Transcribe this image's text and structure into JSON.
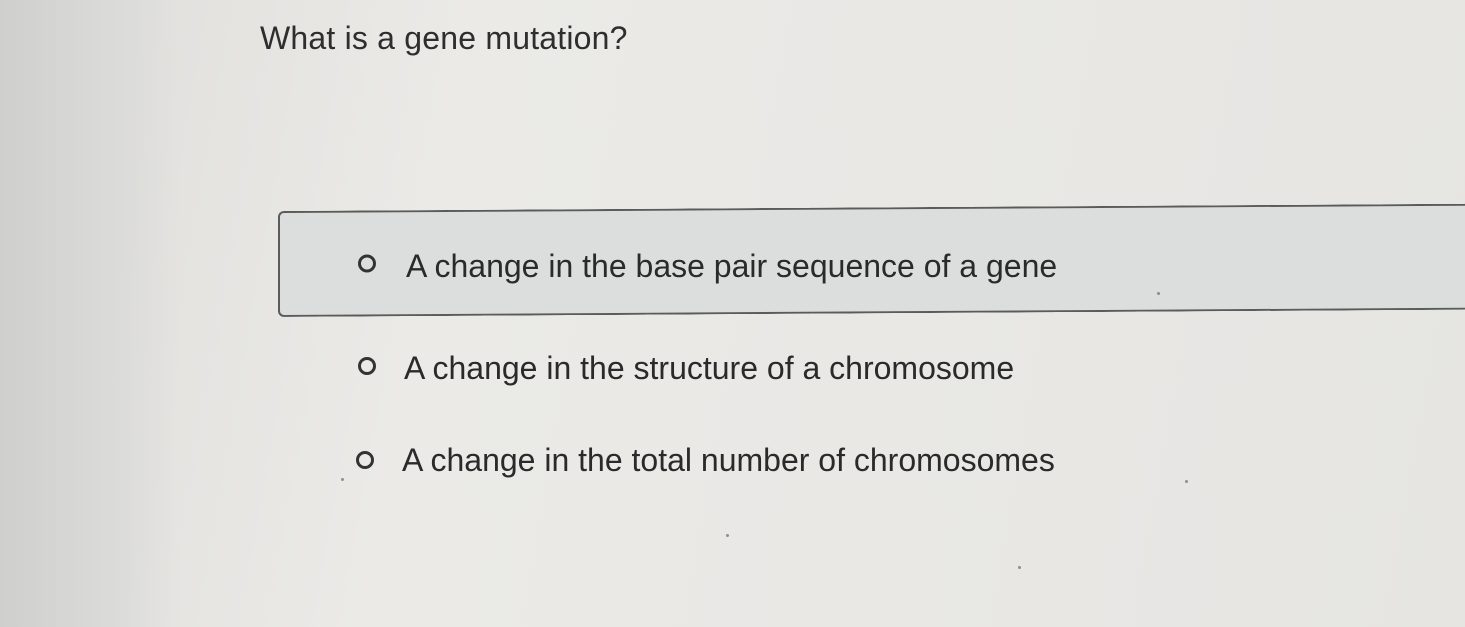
{
  "question": {
    "text": "What is a gene mutation?"
  },
  "options": [
    {
      "label": "A change in the base pair sequence of a gene",
      "selected": false,
      "highlighted": true
    },
    {
      "label": "A change in the structure of a chromosome",
      "selected": false,
      "highlighted": false
    },
    {
      "label": "A change in the total number of chromosomes",
      "selected": false,
      "highlighted": false
    }
  ],
  "colors": {
    "background": "#e9e8e5",
    "highlight_fill": "#dcdedd",
    "highlight_border": "#5a5c5c",
    "text": "#2a2a2a"
  }
}
